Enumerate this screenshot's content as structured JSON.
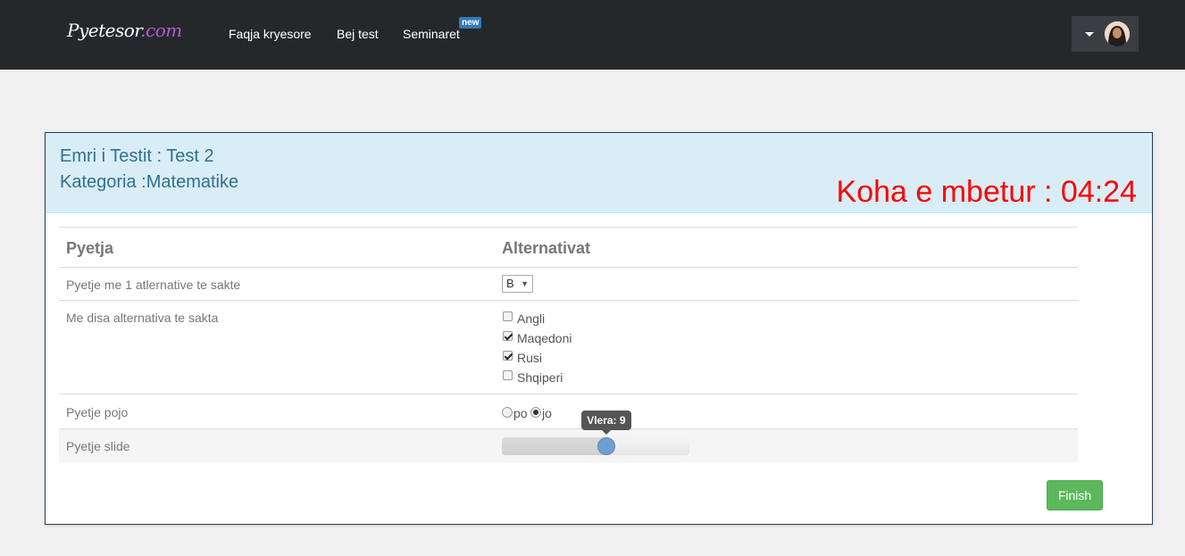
{
  "navbar": {
    "brand_main": "Pyetesor",
    "brand_suffix": ".com",
    "links": [
      "Faqja kryesore",
      "Bej test",
      "Seminaret"
    ],
    "badge": "new"
  },
  "panel": {
    "test_name": "Emri i Testit : Test 2",
    "category": "Kategoria :Matematike",
    "timer_label": "Koha e mbetur : ",
    "timer_value": "04:24"
  },
  "table": {
    "headers": [
      "Pyetja",
      "Alternativat"
    ],
    "q1": {
      "text": "Pyetje me 1 atlernative te sakte",
      "selected": "B"
    },
    "q2": {
      "text": "Me disa alternativa te sakta",
      "options": [
        {
          "label": "Angli",
          "checked": false
        },
        {
          "label": "Maqedoni",
          "checked": true
        },
        {
          "label": "Rusi",
          "checked": true
        },
        {
          "label": "Shqiperi",
          "checked": false
        }
      ]
    },
    "q3": {
      "text": "Pyetje pojo",
      "options": [
        "po",
        "jo"
      ],
      "selected": "jo"
    },
    "q4": {
      "text": "Pyetje slide",
      "tooltip": "Vlera: 9",
      "value": 9,
      "min": 0,
      "max": 16
    }
  },
  "finish_label": "Finish",
  "colors": {
    "navbar": "#25282b",
    "accent_blue": "#31708f",
    "timer": "#ff0000",
    "finish": "#5cb85c",
    "slider_handle": "#6f9fd0"
  },
  "icons": {
    "dropdown": "caret-down-icon",
    "user": "avatar"
  }
}
